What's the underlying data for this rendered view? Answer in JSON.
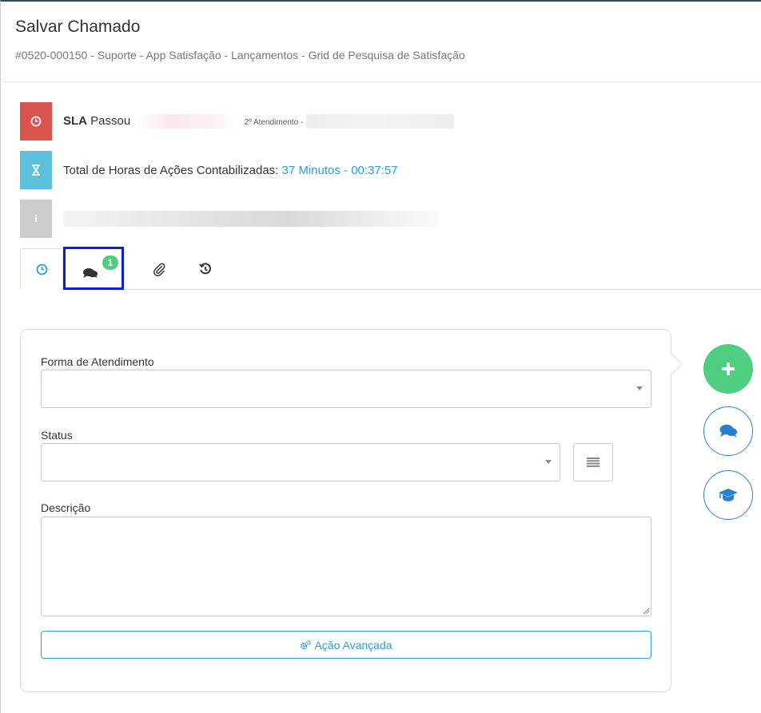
{
  "header": {
    "title": "Salvar Chamado",
    "subtitle": "#0520-000150 - Suporte - App Satisfação - Lançamentos - Grid de Pesquisa de Satisfação"
  },
  "sla": {
    "label_bold": "SLA",
    "label": "Passou",
    "second_attendance_label": "2º Atendimento -",
    "icon": "clock-icon",
    "color": "#d9534f"
  },
  "hours": {
    "label": "Total de Horas de Ações Contabilizadas:",
    "value": "37 Minutos - 00:37:57",
    "icon": "hourglass-icon",
    "color": "#5bc0de"
  },
  "info": {
    "icon": "info-icon",
    "color": "#cccccc"
  },
  "tabs": [
    {
      "name": "tab-time",
      "icon": "clock-icon",
      "active": true
    },
    {
      "name": "tab-comments",
      "icon": "comments-icon",
      "badge": "1",
      "active": false
    },
    {
      "name": "tab-attachments",
      "icon": "paperclip-icon",
      "active": false
    },
    {
      "name": "tab-history",
      "icon": "history-icon",
      "active": false
    }
  ],
  "form": {
    "forma_label": "Forma de Atendimento",
    "forma_value": "",
    "status_label": "Status",
    "status_value": "",
    "descricao_label": "Descrição",
    "descricao_value": "",
    "advanced_button": "Ação Avançada"
  },
  "fabs": [
    {
      "name": "add-button",
      "icon": "plus-icon",
      "color": "#4fce82"
    },
    {
      "name": "chat-button",
      "icon": "comments-icon"
    },
    {
      "name": "training-button",
      "icon": "graduation-cap-icon"
    }
  ],
  "colors": {
    "accent": "#2a9fd6",
    "highlight_border": "#0b1fd6",
    "badge": "#4fce82"
  }
}
